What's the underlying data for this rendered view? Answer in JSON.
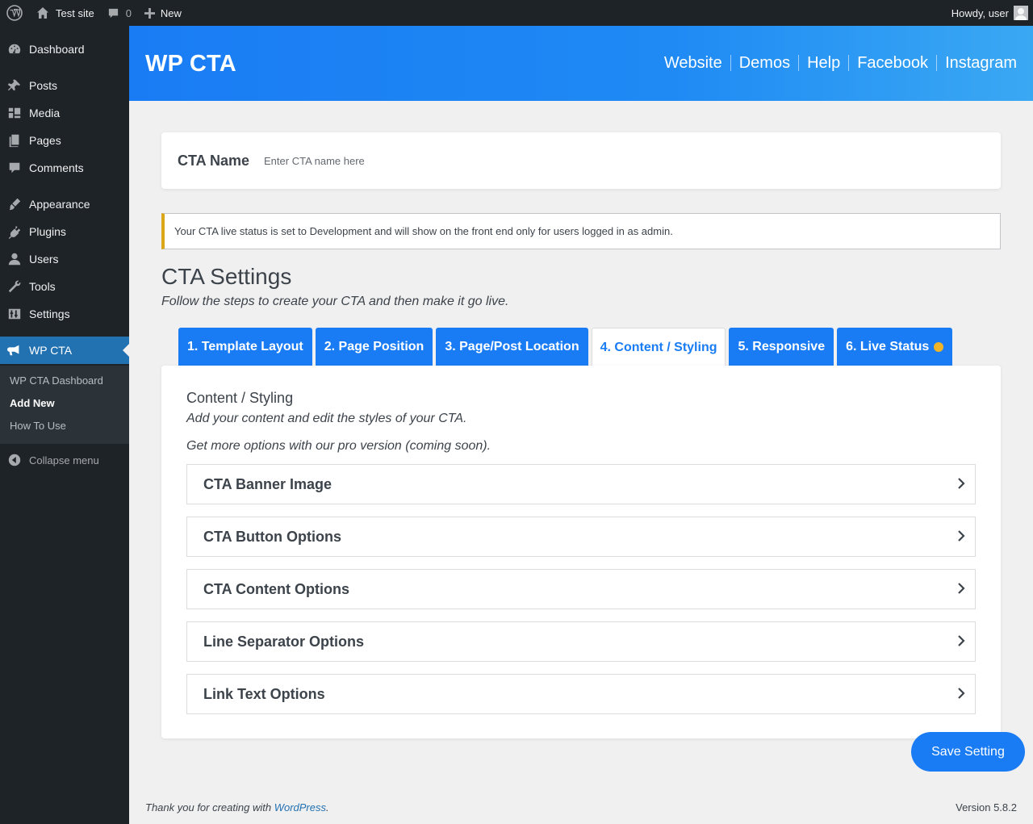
{
  "adminbar": {
    "site_name": "Test site",
    "comments_count": "0",
    "new_label": "New",
    "howdy": "Howdy, user"
  },
  "sidebar": {
    "items": [
      {
        "label": "Dashboard",
        "icon": "dashboard-icon"
      },
      {
        "label": "Posts",
        "icon": "pin-icon"
      },
      {
        "label": "Media",
        "icon": "media-icon"
      },
      {
        "label": "Pages",
        "icon": "pages-icon"
      },
      {
        "label": "Comments",
        "icon": "comments-icon"
      },
      {
        "label": "Appearance",
        "icon": "brush-icon"
      },
      {
        "label": "Plugins",
        "icon": "plug-icon"
      },
      {
        "label": "Users",
        "icon": "user-icon"
      },
      {
        "label": "Tools",
        "icon": "wrench-icon"
      },
      {
        "label": "Settings",
        "icon": "sliders-icon"
      },
      {
        "label": "WP CTA",
        "icon": "megaphone-icon"
      }
    ],
    "submenu": [
      "WP CTA Dashboard",
      "Add New",
      "How To Use"
    ],
    "collapse_label": "Collapse menu"
  },
  "header": {
    "brand": "WP CTA",
    "nav": [
      "Website",
      "Demos",
      "Help",
      "Facebook",
      "Instagram"
    ],
    "gradient_start": "#1a7cf4",
    "gradient_end": "#3aa8f3"
  },
  "cta_name": {
    "label": "CTA Name",
    "placeholder": "Enter CTA name here",
    "value": ""
  },
  "notice": {
    "text": "Your CTA live status is set to Development and will show on the front end only for users logged in as admin.",
    "accent": "#dba617"
  },
  "settings": {
    "title": "CTA Settings",
    "subtitle": "Follow the steps to create your CTA and then make it go live.",
    "tabs": [
      "1. Template Layout",
      "2. Page Position",
      "3. Page/Post Location",
      "4. Content / Styling",
      "5. Responsive",
      "6. Live Status"
    ],
    "active_tab_index": 3,
    "live_status_color": "#f0b429"
  },
  "panel": {
    "title": "Content / Styling",
    "description": "Add your content and edit the styles of your CTA.",
    "pro_note": "Get more options with our pro version (coming soon).",
    "accordions": [
      "CTA Banner Image",
      "CTA Button Options",
      "CTA Content Options",
      "Line Separator Options",
      "Link Text Options"
    ]
  },
  "save_label": "Save Setting",
  "footer": {
    "thanks_prefix": "Thank you for creating with ",
    "thanks_link": "WordPress",
    "thanks_suffix": ".",
    "version": "Version 5.8.2"
  },
  "colors": {
    "accent": "#1a7cf4",
    "sidebar_bg": "#1d2327",
    "current_menu": "#2271b1"
  }
}
